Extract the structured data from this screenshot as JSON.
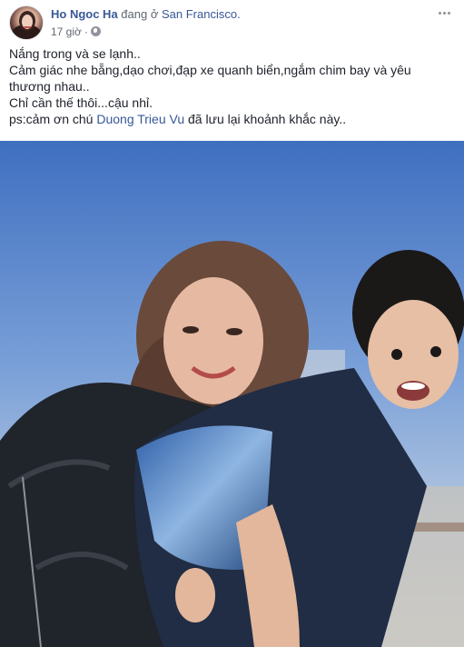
{
  "post": {
    "author_name": "Ho Ngoc Ha",
    "author_connector": "đang ở",
    "location": "San Francisco.",
    "time": "17 giờ",
    "time_separator": "·",
    "privacy_icon": "globe-icon",
    "more_icon": "more-options-icon",
    "text_lines": [
      "Nắng trong và se lạnh..",
      "Cảm giác nhe bẵng,dạo chơi,đạp xe quanh biển,ngắm chim bay và yêu thương nhau..",
      "Chỉ cần thế thôi...cậu nhỉ."
    ],
    "thanks_prefix": "ps:cảm ơn chú ",
    "thanks_tag": "Duong Trieu Vu",
    "thanks_suffix": " đã lưu lại khoảnh khắc này.."
  },
  "colors": {
    "link": "#385898",
    "text": "#1d2129",
    "meta": "#616770"
  }
}
